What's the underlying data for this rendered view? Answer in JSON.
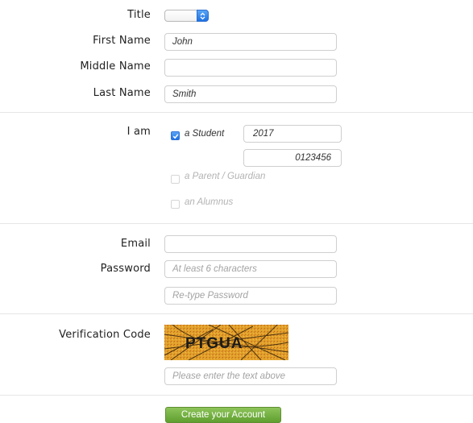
{
  "title_field": {
    "label": "Title",
    "selected": ""
  },
  "first_name": {
    "label": "First Name",
    "value": "John"
  },
  "middle_name": {
    "label": "Middle Name",
    "value": ""
  },
  "last_name": {
    "label": "Last Name",
    "value": "Smith"
  },
  "role": {
    "label": "I am",
    "options": [
      {
        "label": "a Student",
        "checked": true
      },
      {
        "label": "a Parent / Guardian",
        "checked": false
      },
      {
        "label": "an Alumnus",
        "checked": false
      }
    ],
    "student_year": "2017",
    "student_id": "0123456"
  },
  "email": {
    "label": "Email",
    "value": ""
  },
  "password": {
    "label": "Password",
    "placeholder": "At least 6 characters",
    "retype_placeholder": "Re-type Password"
  },
  "verification": {
    "label": "Verification Code",
    "captcha_text": "PTGUA",
    "placeholder": "Please enter the text above"
  },
  "submit_label": "Create your Account",
  "colors": {
    "accent_blue": "#1f72e2",
    "button_green": "#6aa83a",
    "captcha_bg": "#e0a22a"
  }
}
